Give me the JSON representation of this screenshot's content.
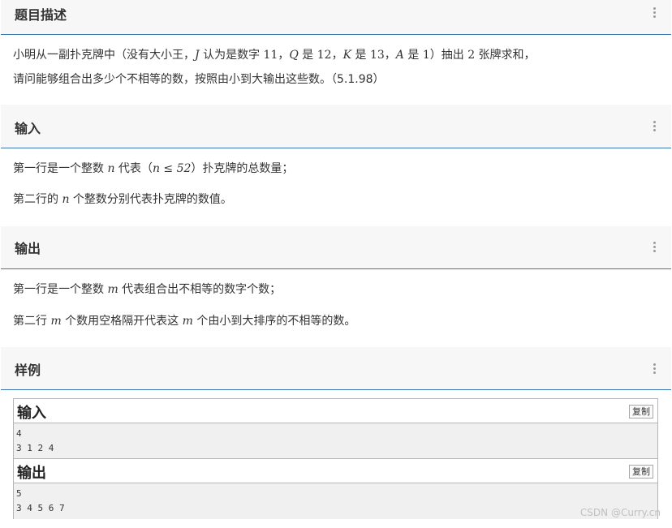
{
  "sections": {
    "description": {
      "title": "题目描述",
      "line1": {
        "a": "小明从一副扑克牌中（没有大小王，",
        "j": "J",
        "b": " 认为是数字 ",
        "j_val": "11",
        "c": "，",
        "q": "Q",
        "d": " 是 ",
        "q_val": "12",
        "e": "，",
        "k": "K",
        "f": " 是 ",
        "k_val": "13",
        "g": "，",
        "a_sym": "A",
        "h": " 是 ",
        "a_val": "1",
        "i": "）抽出 ",
        "n_val": "2",
        "tail": " 张牌求和，"
      },
      "line2": "请问能够组合出多少个不相等的数，按照由小到大输出这些数。（5.1.98）"
    },
    "input": {
      "title": "输入",
      "line1": {
        "a": "第一行是一个整数 ",
        "n": "n",
        "b": " 代表（",
        "cond": "n ≤ 52",
        "c": "）扑克牌的总数量；"
      },
      "line2": {
        "a": "第二行的 ",
        "n": "n",
        "b": " 个整数分别代表扑克牌的数值。"
      }
    },
    "output": {
      "title": "输出",
      "line1": {
        "a": "第一行是一个整数 ",
        "m": "m",
        "b": " 代表组合出不相等的数字个数；"
      },
      "line2": {
        "a": "第二行 ",
        "m": "m",
        "b": " 个数用空格隔开代表这 ",
        "m2": "m",
        "c": " 个由小到大排序的不相等的数。"
      }
    },
    "sample": {
      "title": "样例",
      "input": {
        "label": "输入",
        "copy": "复制",
        "rows": [
          "4",
          "3 1 2 4"
        ]
      },
      "output": {
        "label": "输出",
        "copy": "复制",
        "rows": [
          "5",
          "3 4 5 6 7"
        ]
      }
    }
  },
  "watermark": "CSDN @Curry.cn",
  "colors": {
    "accent": "#3a76b3",
    "header_bg": "#f7f7f7",
    "sample_bg": "#f0f0f0"
  },
  "icons": {
    "section_menu": "kebab-menu-icon"
  }
}
